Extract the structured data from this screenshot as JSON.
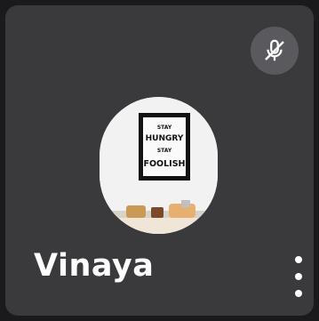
{
  "participant": {
    "name": "Vinaya"
  },
  "avatar": {
    "poster_lines": [
      "STAY",
      "HUNGRY",
      "STAY",
      "FOOLISH"
    ]
  },
  "icons": {
    "mute": "microphone-off-icon",
    "more": "more-vert-icon"
  },
  "colors": {
    "background": "#1a1a1c",
    "tile": "#3a3a3d",
    "mute_badge": "#5a5a5e",
    "text": "#ffffff"
  }
}
